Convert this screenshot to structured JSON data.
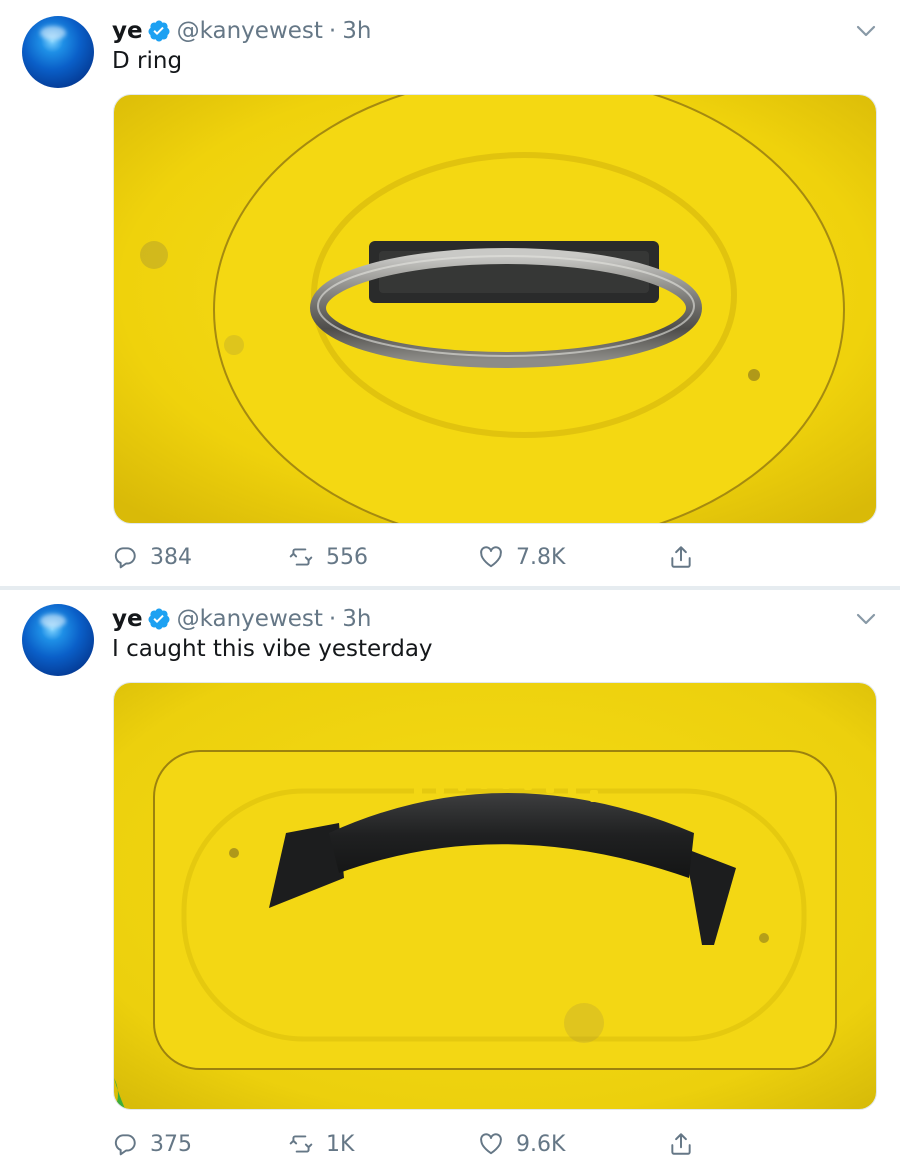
{
  "tweets": [
    {
      "author_name": "ye",
      "handle": "@kanyewest",
      "separator": "·",
      "time": "3h",
      "text": "D ring",
      "media_description_icon": "photo",
      "stats": {
        "replies": "384",
        "retweets": "556",
        "likes": "7.8K"
      }
    },
    {
      "author_name": "ye",
      "handle": "@kanyewest",
      "separator": "·",
      "time": "3h",
      "text": "I caught this vibe yesterday",
      "media_description_icon": "photo",
      "stats": {
        "replies": "375",
        "retweets": "1K",
        "likes": "9.6K"
      }
    }
  ],
  "colors": {
    "verified_blue": "#1da1f2",
    "secondary_text": "#657786",
    "yellow_surface": "#f2d60c"
  }
}
